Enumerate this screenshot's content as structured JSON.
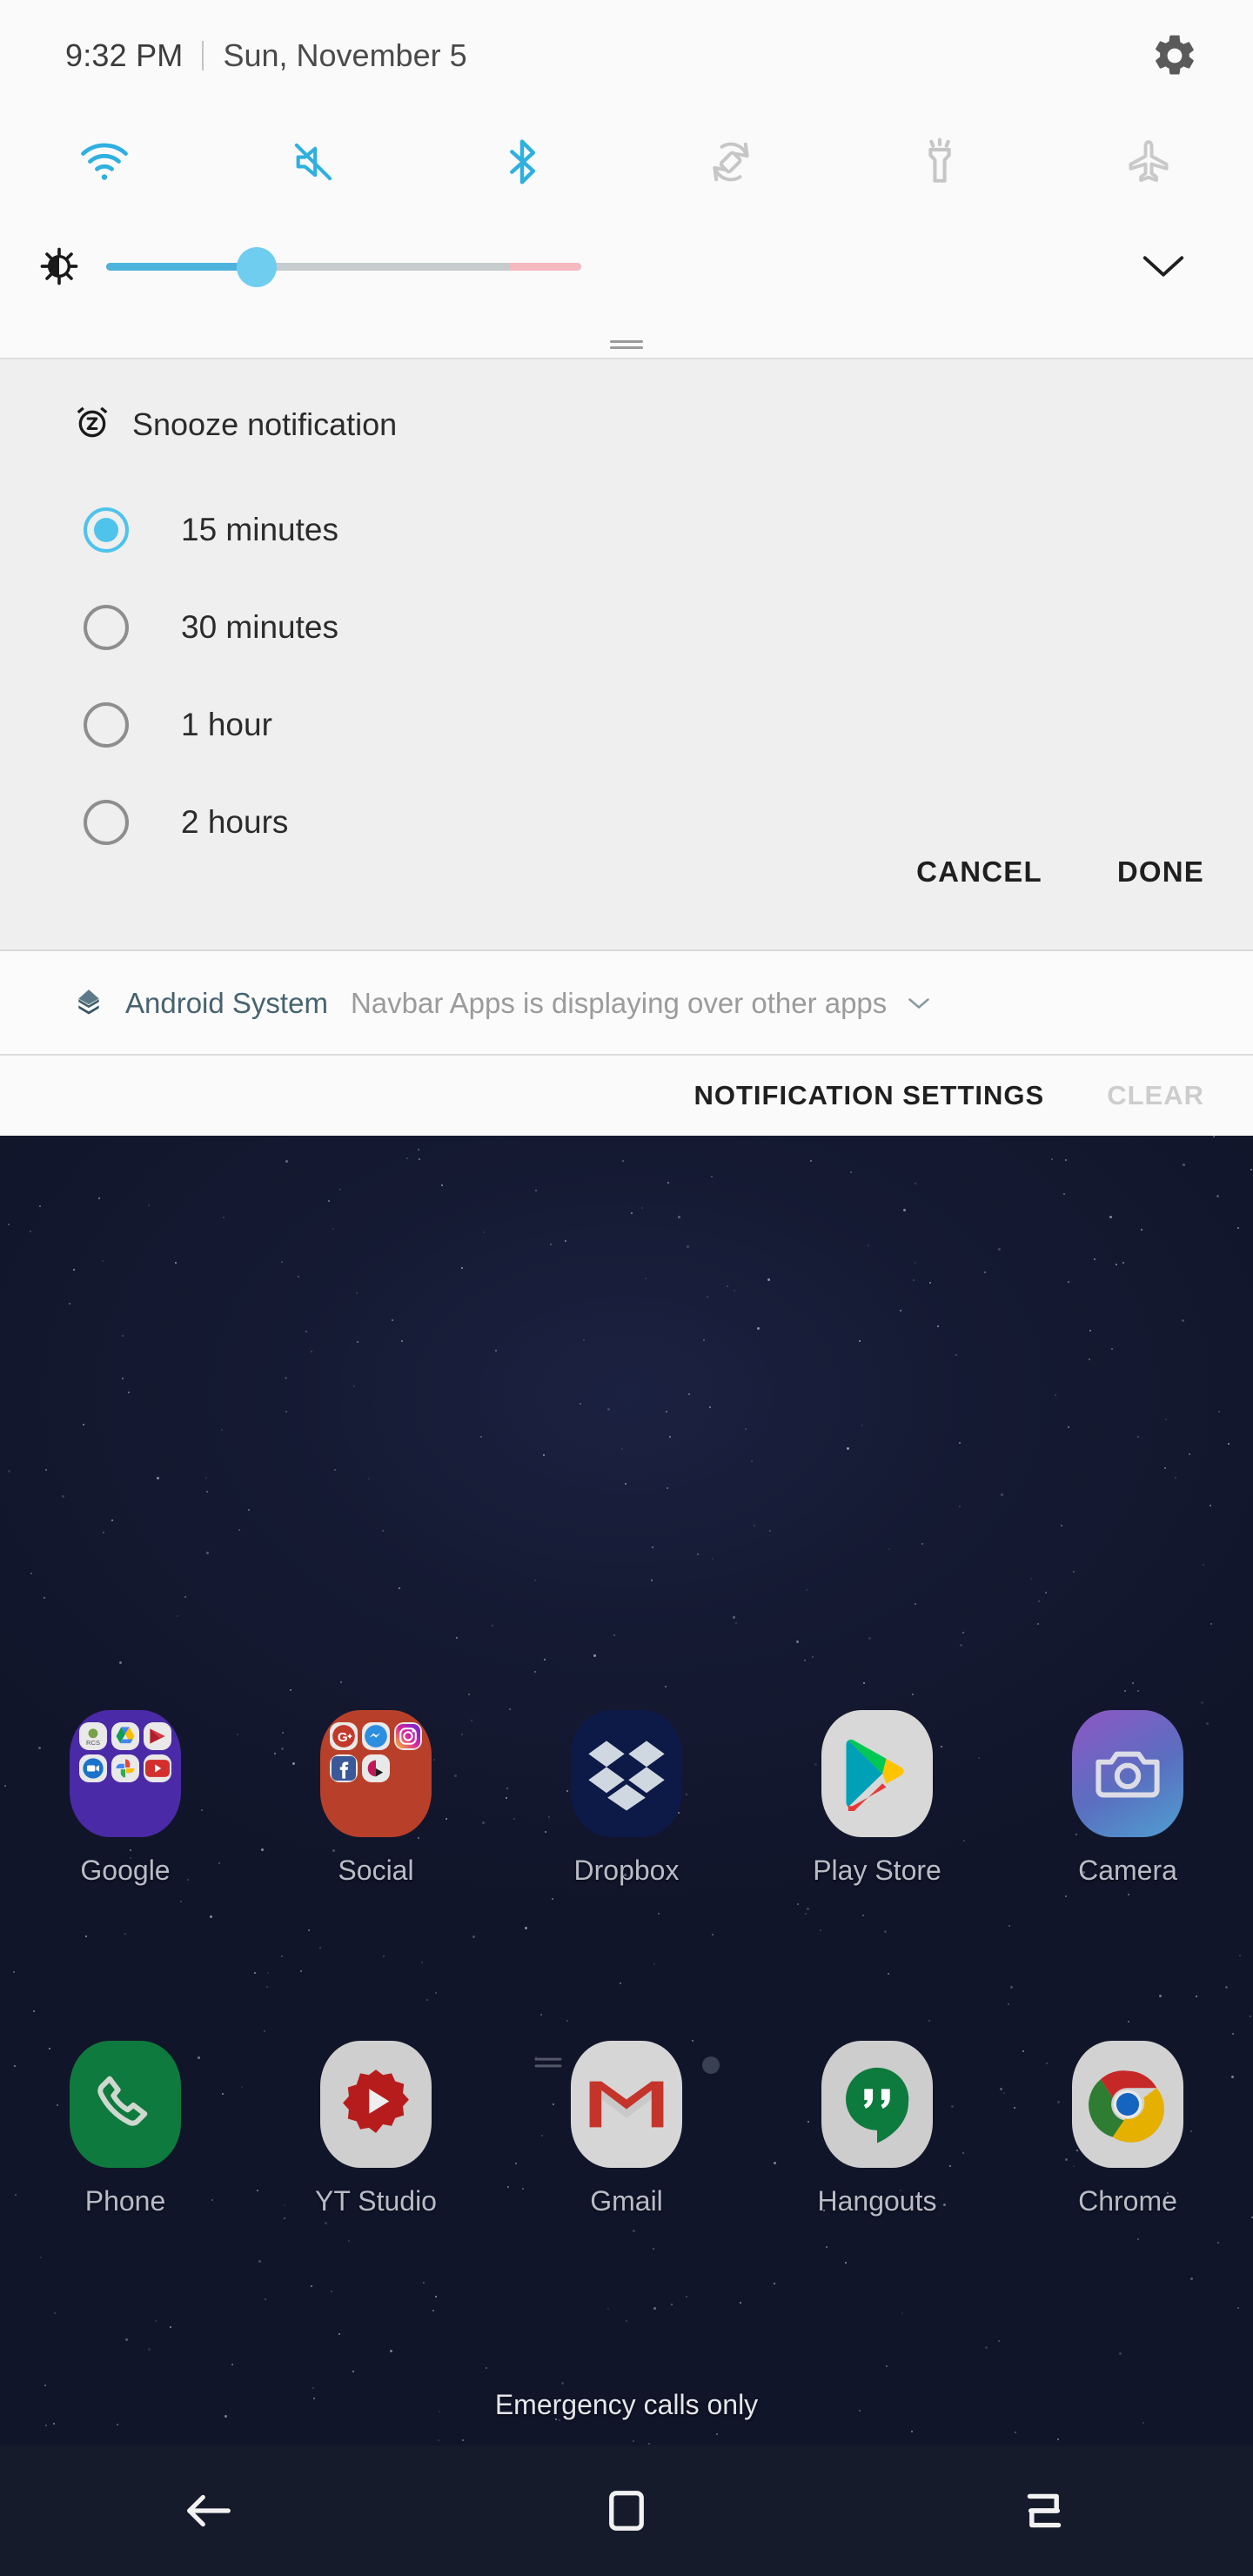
{
  "status_bar": {
    "time": "9:32 PM",
    "date": "Sun, November 5",
    "settings_icon": "gear-icon"
  },
  "quick_settings": {
    "toggles": [
      {
        "name": "wifi",
        "label": "Wi-Fi",
        "icon": "wifi-icon",
        "active": true
      },
      {
        "name": "sound",
        "label": "Mute",
        "icon": "volume-mute-icon",
        "active": true
      },
      {
        "name": "bluetooth",
        "label": "Bluetooth",
        "icon": "bluetooth-icon",
        "active": true
      },
      {
        "name": "auto-rotate",
        "label": "Auto rotate",
        "icon": "auto-rotate-icon",
        "active": false
      },
      {
        "name": "flashlight",
        "label": "Flashlight",
        "icon": "flashlight-icon",
        "active": false
      },
      {
        "name": "airplane-mode",
        "label": "Airplane mode",
        "icon": "airplane-icon",
        "active": false
      }
    ],
    "brightness": {
      "icon": "brightness-icon",
      "value_percent": 32,
      "expand_icon": "chevron-down-icon"
    },
    "colors": {
      "active": "#2eb0e0",
      "inactive": "#c8c8c8",
      "slider_fill": "#4eb3dc",
      "slider_thumb": "#6fcdf0",
      "slider_track": "#c6ccce",
      "slider_warm": "#f4b9be"
    }
  },
  "snooze": {
    "icon": "alarm-snooze-icon",
    "title": "Snooze notification",
    "options": [
      {
        "label": "15 minutes",
        "selected": true
      },
      {
        "label": "30 minutes",
        "selected": false
      },
      {
        "label": "1 hour",
        "selected": false
      },
      {
        "label": "2 hours",
        "selected": false
      }
    ],
    "cancel_label": "CANCEL",
    "done_label": "DONE"
  },
  "system_notification": {
    "icon": "android-system-icon",
    "app_name": "Android System",
    "message": "Navbar Apps is displaying over other apps",
    "expand_icon": "chevron-down-icon"
  },
  "notification_footer": {
    "settings_label": "NOTIFICATION SETTINGS",
    "clear_label": "CLEAR"
  },
  "home_screen": {
    "row1": [
      {
        "label": "Google",
        "icon": "folder-icon",
        "type": "folder",
        "color": "#4b2aa8"
      },
      {
        "label": "Social",
        "icon": "folder-icon",
        "type": "folder",
        "color": "#b8402a"
      },
      {
        "label": "Dropbox",
        "icon": "dropbox-icon",
        "type": "app",
        "color": "#0d1947"
      },
      {
        "label": "Play Store",
        "icon": "play-store-icon",
        "type": "app",
        "color": "#d8d8d8"
      },
      {
        "label": "Camera",
        "icon": "camera-icon",
        "type": "app",
        "color": "#6d5bb5"
      }
    ],
    "row2": [
      {
        "label": "Phone",
        "icon": "phone-icon",
        "type": "app",
        "color": "#0e7a3e"
      },
      {
        "label": "YT Studio",
        "icon": "youtube-studio-icon",
        "type": "app",
        "color": "#d0d0d0"
      },
      {
        "label": "Gmail",
        "icon": "gmail-icon",
        "type": "app",
        "color": "#d6d6d6"
      },
      {
        "label": "Hangouts",
        "icon": "hangouts-icon",
        "type": "app",
        "color": "#d0d0d0"
      },
      {
        "label": "Chrome",
        "icon": "chrome-icon",
        "type": "app",
        "color": "#d2d2d2"
      }
    ],
    "google_folder_apps": [
      "rcs-icon",
      "google-drive-icon",
      "google-play-movies-icon",
      "google-duo-icon",
      "google-photos-icon",
      "youtube-icon"
    ],
    "social_folder_apps": [
      "google-plus-icon",
      "messenger-icon",
      "instagram-icon",
      "facebook-icon",
      "pie-control-icon"
    ],
    "page_indicators": [
      "menu-page-icon",
      "home-page-icon",
      "dot-page-icon"
    ],
    "carrier_status": "Emergency calls only"
  },
  "navbar": {
    "buttons": [
      {
        "name": "back",
        "icon": "back-arrow-icon"
      },
      {
        "name": "home",
        "icon": "home-square-icon"
      },
      {
        "name": "recents",
        "icon": "recents-icon"
      }
    ]
  }
}
